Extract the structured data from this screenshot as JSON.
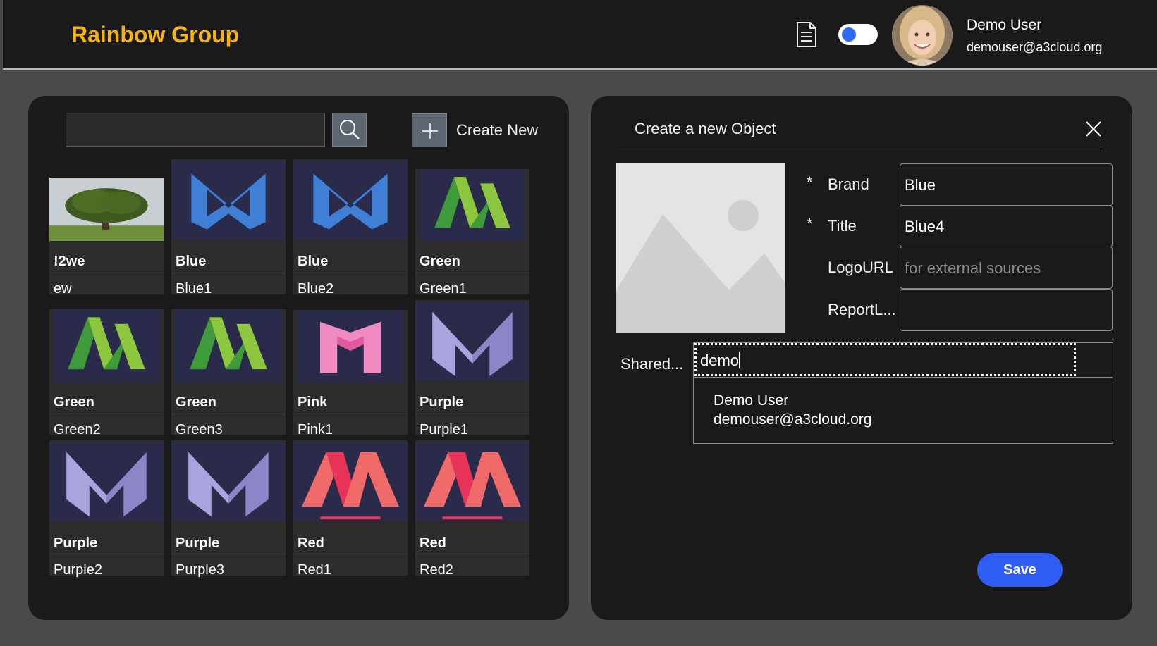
{
  "header": {
    "app_title": "Rainbow Group",
    "user_name": "Demo User",
    "user_email": "demouser@a3cloud.org",
    "doc_icon": "document-icon",
    "toggle_state": "on"
  },
  "colors": {
    "brand": "#f5b40f",
    "accent": "#2f5cf5",
    "panel": "#1a1a1a",
    "background": "#4a4a4a"
  },
  "gallery": {
    "search_placeholder": "",
    "create_label": "Create New",
    "items": [
      {
        "title": "!2we",
        "subtitle": "ew",
        "logo": "tree-photo"
      },
      {
        "title": "Blue",
        "subtitle": "Blue1",
        "logo": "blue-m-logo"
      },
      {
        "title": "Blue",
        "subtitle": "Blue2",
        "logo": "blue-m-logo"
      },
      {
        "title": "Green",
        "subtitle": "Green1",
        "logo": "green-m-logo"
      },
      {
        "title": "Green",
        "subtitle": "Green2",
        "logo": "green-m-logo"
      },
      {
        "title": "Green",
        "subtitle": "Green3",
        "logo": "green-m-logo"
      },
      {
        "title": "Pink",
        "subtitle": "Pink1",
        "logo": "pink-m-logo"
      },
      {
        "title": "Purple",
        "subtitle": "Purple1",
        "logo": "purple-m-logo"
      },
      {
        "title": "Purple",
        "subtitle": "Purple2",
        "logo": "purple-m-logo"
      },
      {
        "title": "Purple",
        "subtitle": "Purple3",
        "logo": "purple-m-logo"
      },
      {
        "title": "Red",
        "subtitle": "Red1",
        "logo": "red-m-logo"
      },
      {
        "title": "Red",
        "subtitle": "Red2",
        "logo": "red-m-logo"
      }
    ]
  },
  "form": {
    "title": "Create a new Object",
    "required_mark": "*",
    "fields": [
      {
        "label": "Brand",
        "value": "Blue",
        "placeholder": "",
        "required": true
      },
      {
        "label": "Title",
        "value": "Blue4",
        "placeholder": "",
        "required": true
      },
      {
        "label": "LogoURL",
        "value": "",
        "placeholder": "for external sources",
        "required": false
      },
      {
        "label": "ReportL...",
        "value": "",
        "placeholder": "",
        "required": false
      }
    ],
    "shared_label": "Shared...",
    "shared_value": "demo",
    "suggestion_name": "Demo User",
    "suggestion_email": "demouser@a3cloud.org",
    "save_label": "Save"
  }
}
